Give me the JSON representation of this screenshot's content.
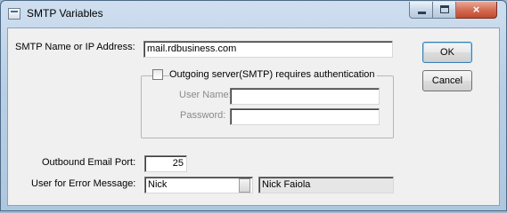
{
  "window": {
    "title": "SMTP Variables",
    "controls": {
      "minimize": "minimize",
      "maximize": "maximize",
      "close": "×"
    }
  },
  "form": {
    "smtp_label": "SMTP Name or IP Address:",
    "smtp_value": "mail.rdbusiness.com",
    "auth": {
      "checkbox_label": "Outgoing server(SMTP) requires authentication",
      "checked": false,
      "username_label": "User Name:",
      "username_value": "",
      "password_label": "Password:",
      "password_value": ""
    },
    "port_label": "Outbound Email Port:",
    "port_value": "25",
    "error_user_label": "User for Error Message:",
    "error_user_value": "Nick",
    "error_user_fullname": "Nick Faiola"
  },
  "buttons": {
    "ok": "OK",
    "cancel": "Cancel"
  }
}
